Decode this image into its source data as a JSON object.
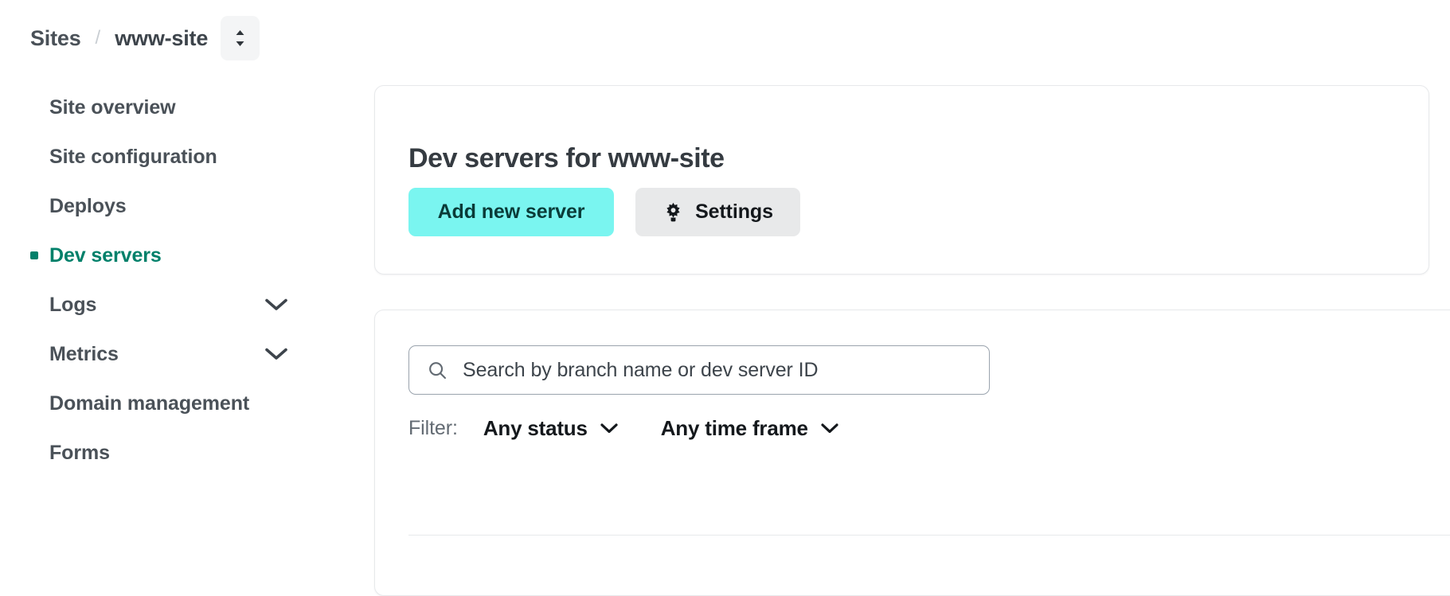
{
  "breadcrumb": {
    "root_label": "Sites",
    "separator": "/",
    "current_label": "www-site",
    "switcher_icon": "chevron-up-down-icon"
  },
  "sidebar": {
    "items": [
      {
        "label": "Site overview",
        "active": false,
        "has_chevron": false
      },
      {
        "label": "Site configuration",
        "active": false,
        "has_chevron": false
      },
      {
        "label": "Deploys",
        "active": false,
        "has_chevron": false
      },
      {
        "label": "Dev servers",
        "active": true,
        "has_chevron": false
      },
      {
        "label": "Logs",
        "active": false,
        "has_chevron": true
      },
      {
        "label": "Metrics",
        "active": false,
        "has_chevron": true
      },
      {
        "label": "Domain management",
        "active": false,
        "has_chevron": false
      },
      {
        "label": "Forms",
        "active": false,
        "has_chevron": false
      }
    ]
  },
  "header_card": {
    "title": "Dev servers for www-site",
    "primary_button": {
      "label": "Add new server"
    },
    "secondary_button": {
      "label": "Settings",
      "icon": "gear-icon"
    }
  },
  "list_card": {
    "search": {
      "placeholder": "Search by branch name or dev server ID",
      "value": "",
      "icon": "search-icon"
    },
    "filter": {
      "label": "Filter:",
      "selects": [
        {
          "value": "Any status",
          "icon": "chevron-down-icon"
        },
        {
          "value": "Any time frame",
          "icon": "chevron-down-icon"
        }
      ]
    }
  },
  "colors": {
    "accent_teal": "#00806a",
    "primary_button_bg": "#7af5f0",
    "primary_button_text": "#0a3b38",
    "secondary_button_bg": "#e8e9ea",
    "text_default": "#4a5158",
    "border": "#e7e9eb"
  }
}
